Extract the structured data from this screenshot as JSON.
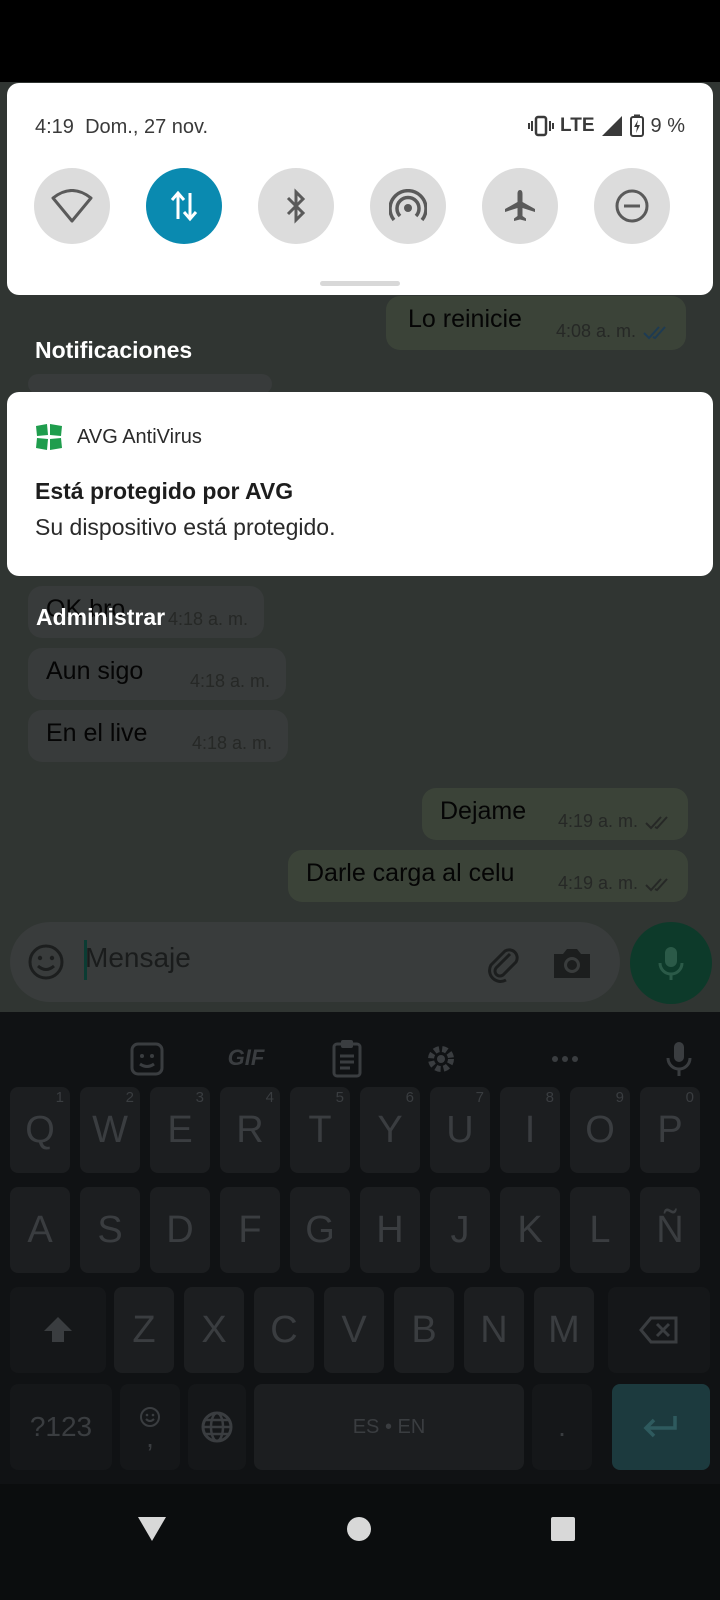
{
  "status_bar": {
    "time": "4:19",
    "date": "Dom., 27 nov.",
    "network": "LTE",
    "battery": "9 %"
  },
  "quick_tiles": [
    {
      "icon": "wifi-icon",
      "active": false
    },
    {
      "icon": "mobile-data-icon",
      "active": true
    },
    {
      "icon": "bluetooth-icon",
      "active": false
    },
    {
      "icon": "hotspot-icon",
      "active": false
    },
    {
      "icon": "airplane-icon",
      "active": false
    },
    {
      "icon": "do-not-disturb-icon",
      "active": false
    }
  ],
  "shade": {
    "notifications_header": "Notificaciones",
    "manage_label": "Administrar"
  },
  "notification": {
    "app_name": "AVG AntiVirus",
    "title": "Está protegido por AVG",
    "body": "Su dispositivo está protegido."
  },
  "chat": {
    "messages": [
      {
        "text": "Lo reinicie",
        "time": "4:08 a. m.",
        "direction": "out"
      },
      {
        "text": "OK bro",
        "time": "4:18 a. m.",
        "direction": "in"
      },
      {
        "text": "Aun sigo",
        "time": "4:18 a. m.",
        "direction": "in"
      },
      {
        "text": "En el live",
        "time": "4:18 a. m.",
        "direction": "in"
      },
      {
        "text": "Dejame",
        "time": "4:19 a. m.",
        "direction": "out"
      },
      {
        "text": "Darle carga al celu",
        "time": "4:19 a. m.",
        "direction": "out"
      }
    ],
    "compose_placeholder": "Mensaje"
  },
  "keyboard": {
    "toolbar": [
      "back-icon",
      "sticker-icon",
      "gif-icon",
      "clipboard-icon",
      "settings-icon",
      "more-icon",
      "mic-icon"
    ],
    "gif_label": "GIF",
    "row1": [
      "Q",
      "W",
      "E",
      "R",
      "T",
      "Y",
      "U",
      "I",
      "O",
      "P"
    ],
    "row1_hints": [
      "1",
      "2",
      "3",
      "4",
      "5",
      "6",
      "7",
      "8",
      "9",
      "0"
    ],
    "row2": [
      "A",
      "S",
      "D",
      "F",
      "G",
      "H",
      "J",
      "K",
      "L",
      "Ñ"
    ],
    "row3": [
      "Z",
      "X",
      "C",
      "V",
      "B",
      "N",
      "M"
    ],
    "symbols_label": "?123",
    "comma_label": ",",
    "space_label": "ES • EN",
    "period_label": "."
  }
}
